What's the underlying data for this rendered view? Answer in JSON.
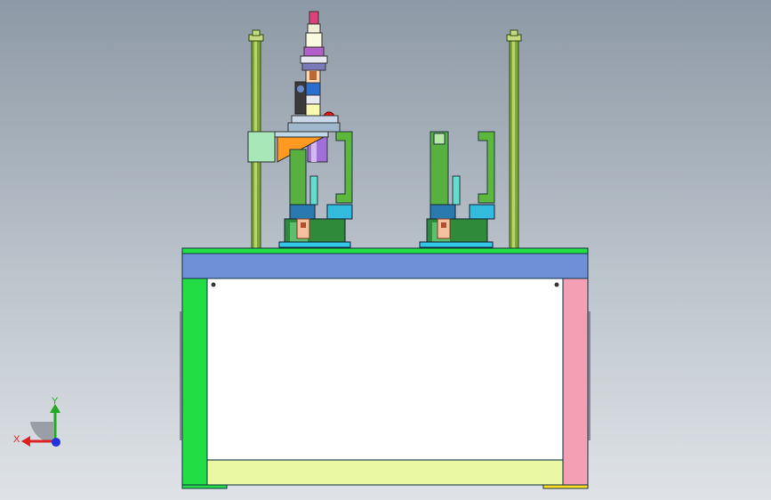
{
  "viewport": {
    "background_top": "#8d99a6",
    "background_bottom": "#dfe3e7"
  },
  "model": {
    "icon": "machine-assembly-icon",
    "colors": {
      "base_top_bar": "#6f8fd6",
      "base_green": "#22dd44",
      "base_white": "#ffffff",
      "base_bottom_panel": "#eaf8a4",
      "base_right_panel": "#f4a0b4",
      "column_green": "#7fa83a",
      "bracket_orange": "#ff9920",
      "cylinder_purple": "#a070d8",
      "cyan_part": "#33bbdd",
      "dark_green": "#2f7a3a"
    }
  },
  "triad": {
    "x_label": "X",
    "y_label": "Y",
    "x_color": "#dd2222",
    "y_color": "#22aa22",
    "z_color": "#2233dd"
  }
}
